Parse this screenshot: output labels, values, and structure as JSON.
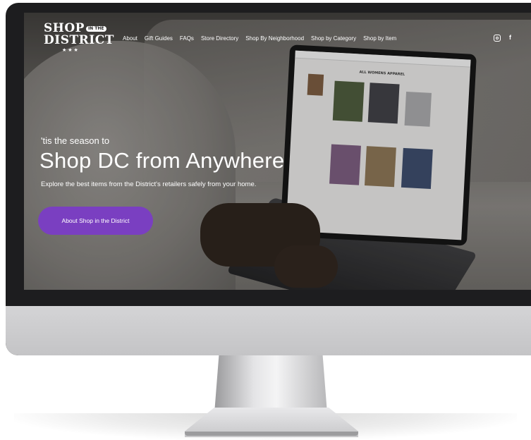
{
  "logo": {
    "word1": "SHOP",
    "tag": "IN THE",
    "word2": "DISTRICT",
    "stars": "★★★"
  },
  "nav": {
    "items": [
      "About",
      "Gift Guides",
      "FAQs",
      "Store Directory",
      "Shop By Neighborhood",
      "Shop by Category",
      "Shop by Item"
    ]
  },
  "social": {
    "instagram_icon": "instagram-icon",
    "facebook_icon": "facebook-icon",
    "facebook_glyph": "f"
  },
  "hero": {
    "subtitle": "'tis the season to",
    "title": "Shop DC from Anywhere",
    "description": "Explore the best items from the District's retailers safely from your home.",
    "cta": "About Shop in the District"
  },
  "laptop": {
    "page_heading": "ALL WOMENS APPAREL"
  },
  "colors": {
    "accent": "#7a3fc1",
    "bezel": "#1d1d1f",
    "chin": "#c9c9cb"
  }
}
